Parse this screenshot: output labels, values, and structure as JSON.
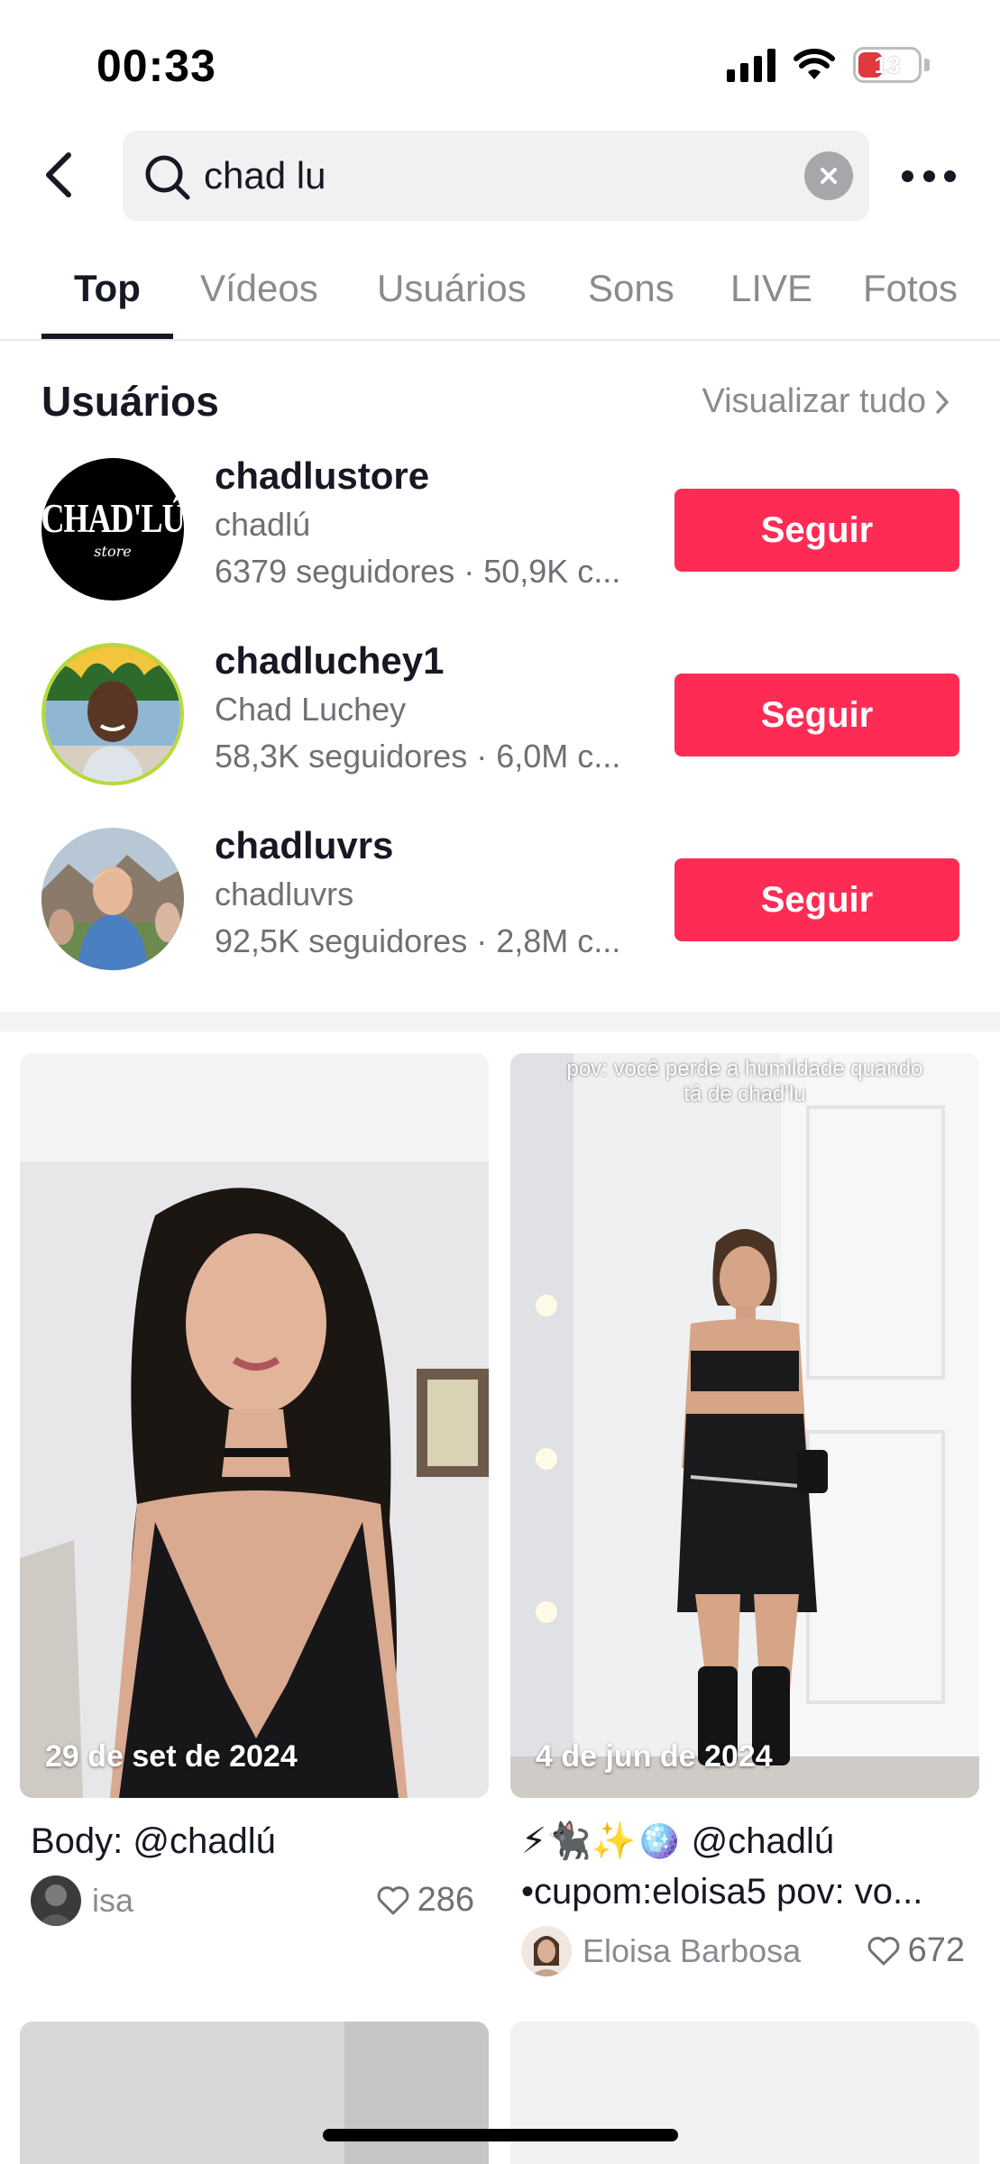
{
  "status_bar": {
    "time": "00:33",
    "battery": "13"
  },
  "search": {
    "query": "chad lu"
  },
  "tabs": [
    {
      "label": "Top",
      "active": true
    },
    {
      "label": "Vídeos"
    },
    {
      "label": "Usuários"
    },
    {
      "label": "Sons"
    },
    {
      "label": "LIVE"
    },
    {
      "label": "Fotos"
    }
  ],
  "users_section": {
    "title": "Usuários",
    "view_all": "Visualizar tudo",
    "users": [
      {
        "username": "chadlustore",
        "nickname": "chadlú",
        "stats": "6379 seguidores · 50,9K c...",
        "follow_label": "Seguir",
        "avatar_text": "CHAD'LÚ",
        "avatar_subtext": "store"
      },
      {
        "username": "chadluchey1",
        "nickname": "Chad Luchey",
        "stats": "58,3K seguidores · 6,0M c...",
        "follow_label": "Seguir"
      },
      {
        "username": "chadluvrs",
        "nickname": "chadluvrs",
        "stats": "92,5K seguidores · 2,8M c...",
        "follow_label": "Seguir"
      }
    ]
  },
  "videos": [
    {
      "date": "29 de set de 2024",
      "caption": "Body: @chadlú",
      "author": "isa",
      "likes": "286"
    },
    {
      "date": "4 de jun de 2024",
      "overlay_text": "pov: você perde a humildade quando tá de chad'lu",
      "caption_line1": "⚡🐈‍⬛✨🪩 @chadlú",
      "caption_line2": "•cupom:eloisa5 pov: vo...",
      "author": "Eloisa Barbosa",
      "likes": "672"
    }
  ],
  "colors": {
    "accent": "#fe2c55",
    "text": "#161823",
    "secondary": "#8a8b91"
  }
}
